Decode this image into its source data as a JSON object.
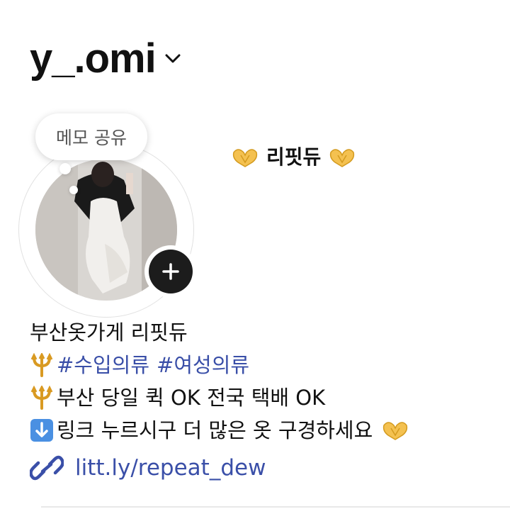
{
  "profile": {
    "username": "y_.omi",
    "display_name": "리핏듀",
    "note": "메모 공유"
  },
  "bio": {
    "line1": "부산옷가게 리핏듀",
    "line2_hashtags": [
      "#수입의류",
      "#여성의류"
    ],
    "line3": "부산 당일 퀵 OK 전국 택배 OK",
    "line4": "링크 누르시구 더 많은 옷 구경하세요"
  },
  "link": {
    "url": "litt.ly/repeat_dew"
  },
  "icons": {
    "chevron": "chevron-down-icon",
    "add": "plus-icon",
    "link": "link-icon",
    "emoji_heart": "heart-hands-emoji",
    "emoji_trident": "trident-emoji",
    "emoji_down": "down-arrow-emoji"
  },
  "colors": {
    "link": "#3a4fa8",
    "text": "#111111"
  }
}
